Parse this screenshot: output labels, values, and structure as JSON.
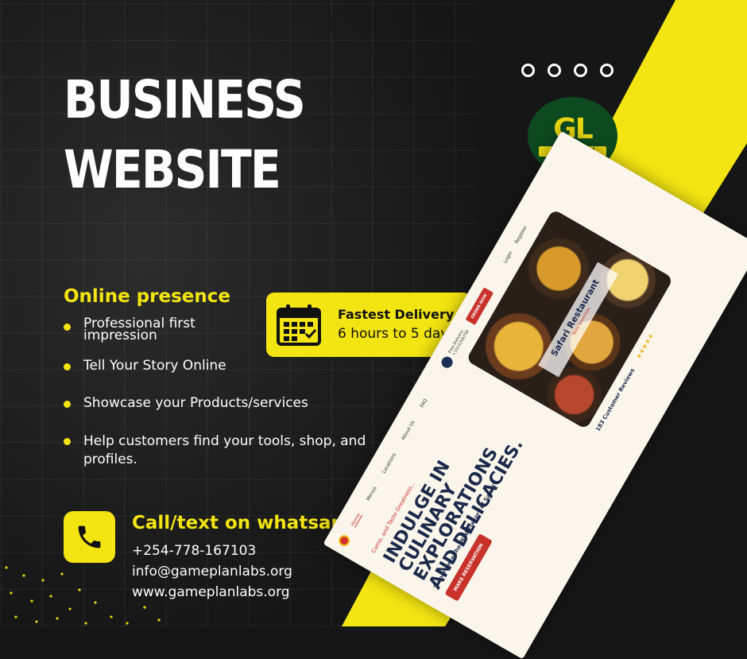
{
  "headline": {
    "line1": "BUSINESS",
    "line2": "WEBSITE"
  },
  "logo": {
    "initials": "GL",
    "name": "GAMEPLAN",
    "sub": "LABS"
  },
  "features": {
    "title": "Online presence",
    "items": [
      "Professional first impression",
      "Tell Your Story Online",
      "Showcase your Products/services",
      "Help customers find your tools, shop, and profiles."
    ]
  },
  "delivery": {
    "title": "Fastest Delivery",
    "subtitle": "6 hours to 5 days"
  },
  "contact": {
    "title": "Call/text on whatsapp",
    "phone": "+254-778-167103",
    "email": "info@gameplanlabs.org",
    "website": "www.gameplanlabs.org"
  },
  "mockup": {
    "nav": [
      "Home",
      "Menus",
      "Locations",
      "About Us",
      "FAQ"
    ],
    "free_delivery": "Free Delivery",
    "free_delivery_number": "+1523256758",
    "order_button": "ORDER NOW",
    "login": "Login",
    "register": "Register",
    "tagline": "Come, and Taste Greatness...",
    "headline": "INDULGE IN CULINARY EXPLORATIONS AND DELICACIES.",
    "subheadline": "\"Experience the Wild Flavors of Safari\"",
    "reservation_button": "MAKE RESERVATION",
    "banner_title": "Safari Restaurant",
    "banner_sub": "Taste Greatness",
    "reviews": "183 Customer Reviews",
    "stars": "★★★★★"
  },
  "colors": {
    "accent": "#f3e512",
    "background": "#161616",
    "brand_red": "#c8322b"
  }
}
